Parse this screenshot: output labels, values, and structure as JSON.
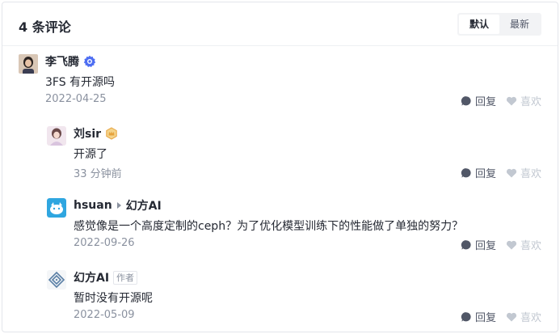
{
  "header": {
    "title": "4 条评论",
    "sort_options": [
      "默认",
      "最新"
    ],
    "active_sort": "默认"
  },
  "comments": [
    {
      "user": "李飞腾",
      "badge": "verified-gear-icon",
      "content": "3FS 有开源吗",
      "time": "2022-04-25",
      "reply_label": "回复",
      "like_label": "喜欢"
    },
    {
      "user": "刘sir",
      "badge": "crown-level-icon",
      "content": "开源了",
      "time": "33 分钟前",
      "reply_label": "回复",
      "like_label": "喜欢"
    },
    {
      "user": "hsuan",
      "reply_to": "幻方AI",
      "content": "感觉像是一个高度定制的ceph？为了优化模型训练下的性能做了单独的努力？",
      "time": "2022-09-26",
      "reply_label": "回复",
      "like_label": "喜欢"
    },
    {
      "user": "幻方AI",
      "author_tag": "作者",
      "content": "暂时没有开源呢",
      "time": "2022-05-09",
      "reply_label": "回复",
      "like_label": "喜欢"
    }
  ],
  "colors": {
    "primary_text": "#252933",
    "secondary_text": "#8a919f",
    "action_text": "#515767",
    "like_text": "#c2c8d1",
    "badge_blue": "#4e6ef2",
    "badge_gold": "#e6a23c"
  }
}
